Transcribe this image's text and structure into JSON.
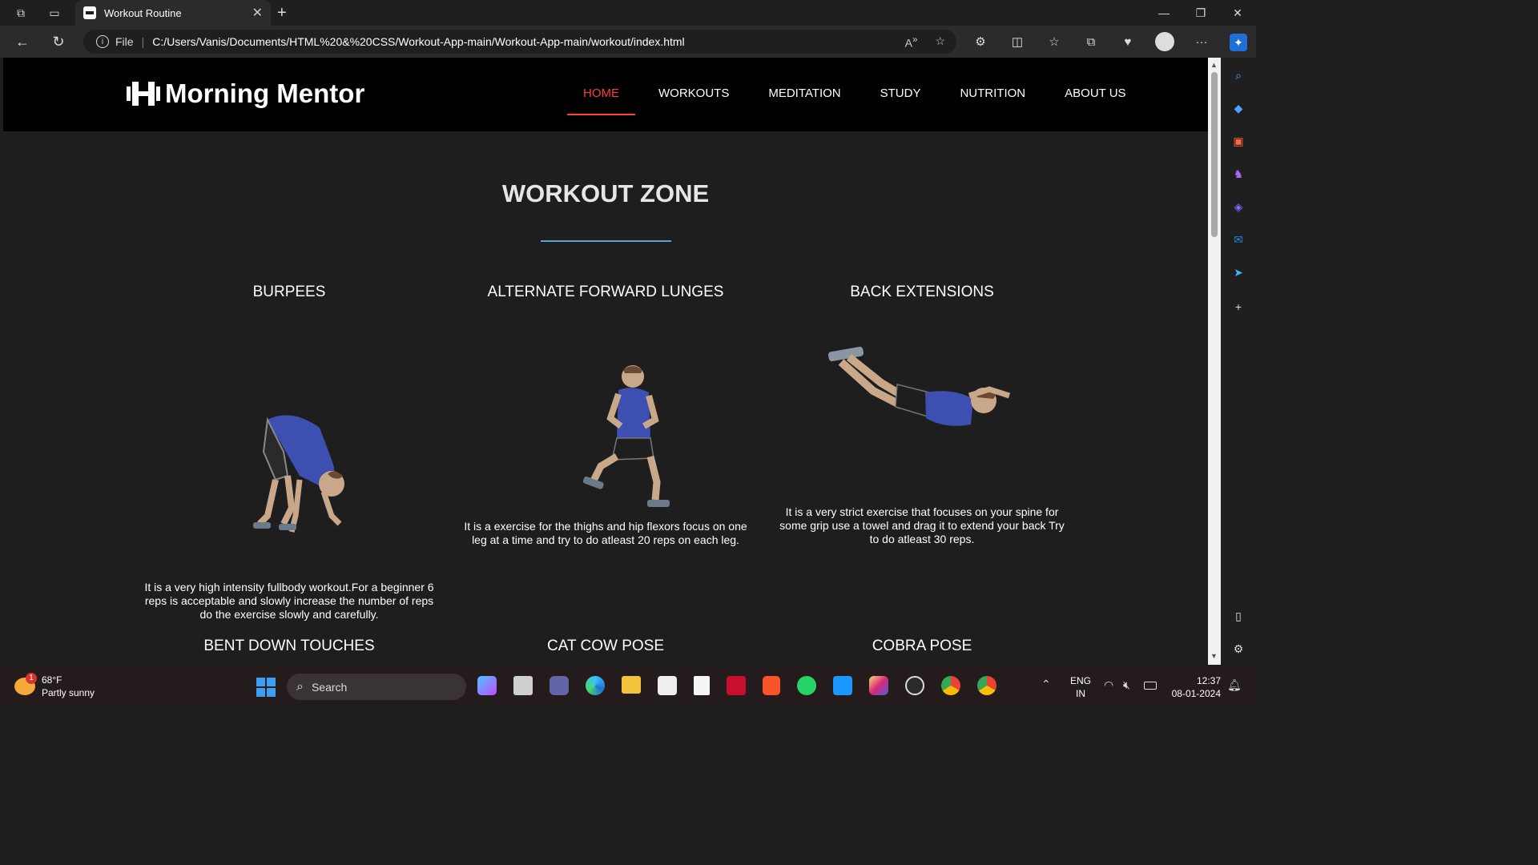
{
  "browser": {
    "tab_title": "Workout Routine",
    "url_scheme": "File",
    "url_path": "C:/Users/Vanis/Documents/HTML%20&%20CSS/Workout-App-main/Workout-App-main/workout/index.html"
  },
  "site": {
    "brand": "Morning Mentor",
    "nav": [
      "HOME",
      "WORKOUTS",
      "MEDITATION",
      "STUDY",
      "NUTRITION",
      "ABOUT US"
    ],
    "active_nav": "HOME"
  },
  "zone": {
    "title": "WORKOUT ZONE",
    "line_color": "#5aa6c8"
  },
  "exercises": [
    {
      "name": "BURPEES",
      "description": "It is a very high intensity fullbody workout.For a beginner 6 reps is acceptable and slowly increase the number of reps do the exercise slowly and carefully."
    },
    {
      "name": "ALTERNATE FORWARD LUNGES",
      "description": "It is a exercise for the thighs and hip flexors focus on one leg at a time and try to do atleast 20 reps on each leg."
    },
    {
      "name": "BACK EXTENSIONS",
      "description": "It is a very strict exercise that focuses on your spine for some grip use a towel and drag it to extend your back Try to do atleast 30 reps."
    },
    {
      "name": "BENT DOWN TOUCHES",
      "description": ""
    },
    {
      "name": "CAT COW POSE",
      "description": ""
    },
    {
      "name": "COBRA POSE",
      "description": ""
    }
  ],
  "taskbar": {
    "weather_temp": "68°F",
    "weather_text": "Partly sunny",
    "weather_badge": "1",
    "search_placeholder": "Search",
    "lang_top": "ENG",
    "lang_bottom": "IN",
    "time": "12:37",
    "date": "08-01-2024"
  },
  "colors": {
    "accent": "#ff3b3b",
    "shirt": "#3d4fb0",
    "page_bg": "#1f1e1e"
  }
}
